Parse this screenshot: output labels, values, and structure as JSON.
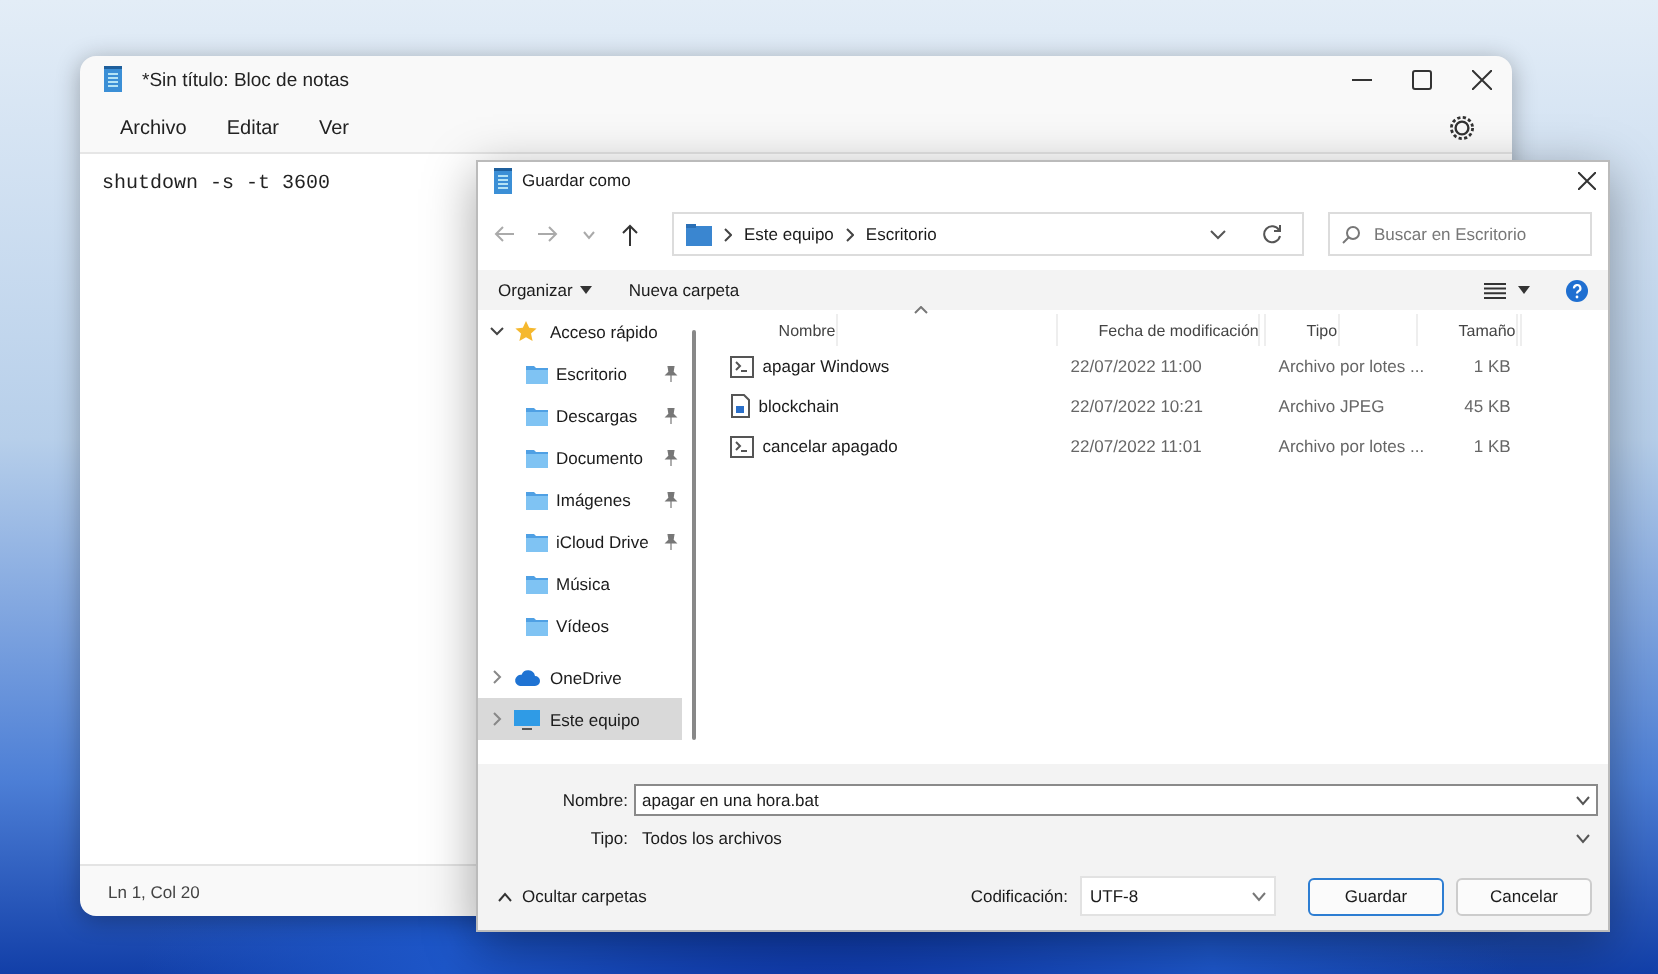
{
  "notepad": {
    "title": "*Sin título: Bloc de notas",
    "menu": [
      "Archivo",
      "Editar",
      "Ver"
    ],
    "content": "shutdown -s -t 3600",
    "status": "Ln 1, Col 20"
  },
  "dialog": {
    "title": "Guardar como",
    "breadcrumb": [
      "Este equipo",
      "Escritorio"
    ],
    "search": {
      "placeholder": "Buscar en Escritorio"
    },
    "toolbar": [
      {
        "label": "Organizar",
        "kind": "menu"
      },
      {
        "label": "Nueva carpeta",
        "kind": "plain"
      }
    ],
    "sidebar": [
      {
        "label": "Acceso rápido",
        "kind": "star",
        "expanded": true,
        "selected": false,
        "children": [
          {
            "label": "Escritorio",
            "pinned": true,
            "selected": false
          },
          {
            "label": "Descargas",
            "pinned": true,
            "selected": false
          },
          {
            "label": "Documento",
            "pinned": true,
            "selected": false
          },
          {
            "label": "Imágenes",
            "pinned": true,
            "selected": false
          },
          {
            "label": "iCloud Drive",
            "pinned": true,
            "selected": false
          },
          {
            "label": "Música",
            "pinned": false,
            "selected": false
          },
          {
            "label": "Vídeos",
            "pinned": false,
            "selected": false
          }
        ]
      },
      {
        "label": "OneDrive",
        "kind": "cloud",
        "expanded": false,
        "selected": false
      },
      {
        "label": "Este equipo",
        "kind": "pc",
        "expanded": false,
        "selected": true
      }
    ],
    "columns": [
      {
        "label": "Nombre",
        "sorted": true
      },
      {
        "label": "Fecha de modificación",
        "sorted": false
      },
      {
        "label": "Tipo",
        "sorted": false
      },
      {
        "label": "Tamaño",
        "sorted": false
      }
    ],
    "files": [
      {
        "name": "apagar Windows",
        "kind": "batch",
        "modified": "22/07/2022 11:00",
        "type": "Archivo por lotes ...",
        "size": "1 KB",
        "selected": false
      },
      {
        "name": "blockchain",
        "kind": "image",
        "modified": "22/07/2022 10:21",
        "type": "Archivo JPEG",
        "size": "45 KB",
        "selected": false
      },
      {
        "name": "cancelar apagado",
        "kind": "batch",
        "modified": "22/07/2022 11:01",
        "type": "Archivo por lotes ...",
        "size": "1 KB",
        "selected": false
      }
    ],
    "filename": {
      "label": "Nombre:",
      "value": "apagar en una hora.bat"
    },
    "filetype": {
      "label": "Tipo:",
      "value": "Todos los archivos"
    },
    "hide_folders": "Ocultar carpetas",
    "encoding": {
      "label": "Codificación:",
      "value": "UTF-8"
    },
    "buttons": [
      {
        "label": "Guardar",
        "primary": true
      },
      {
        "label": "Cancelar",
        "primary": false
      }
    ]
  }
}
